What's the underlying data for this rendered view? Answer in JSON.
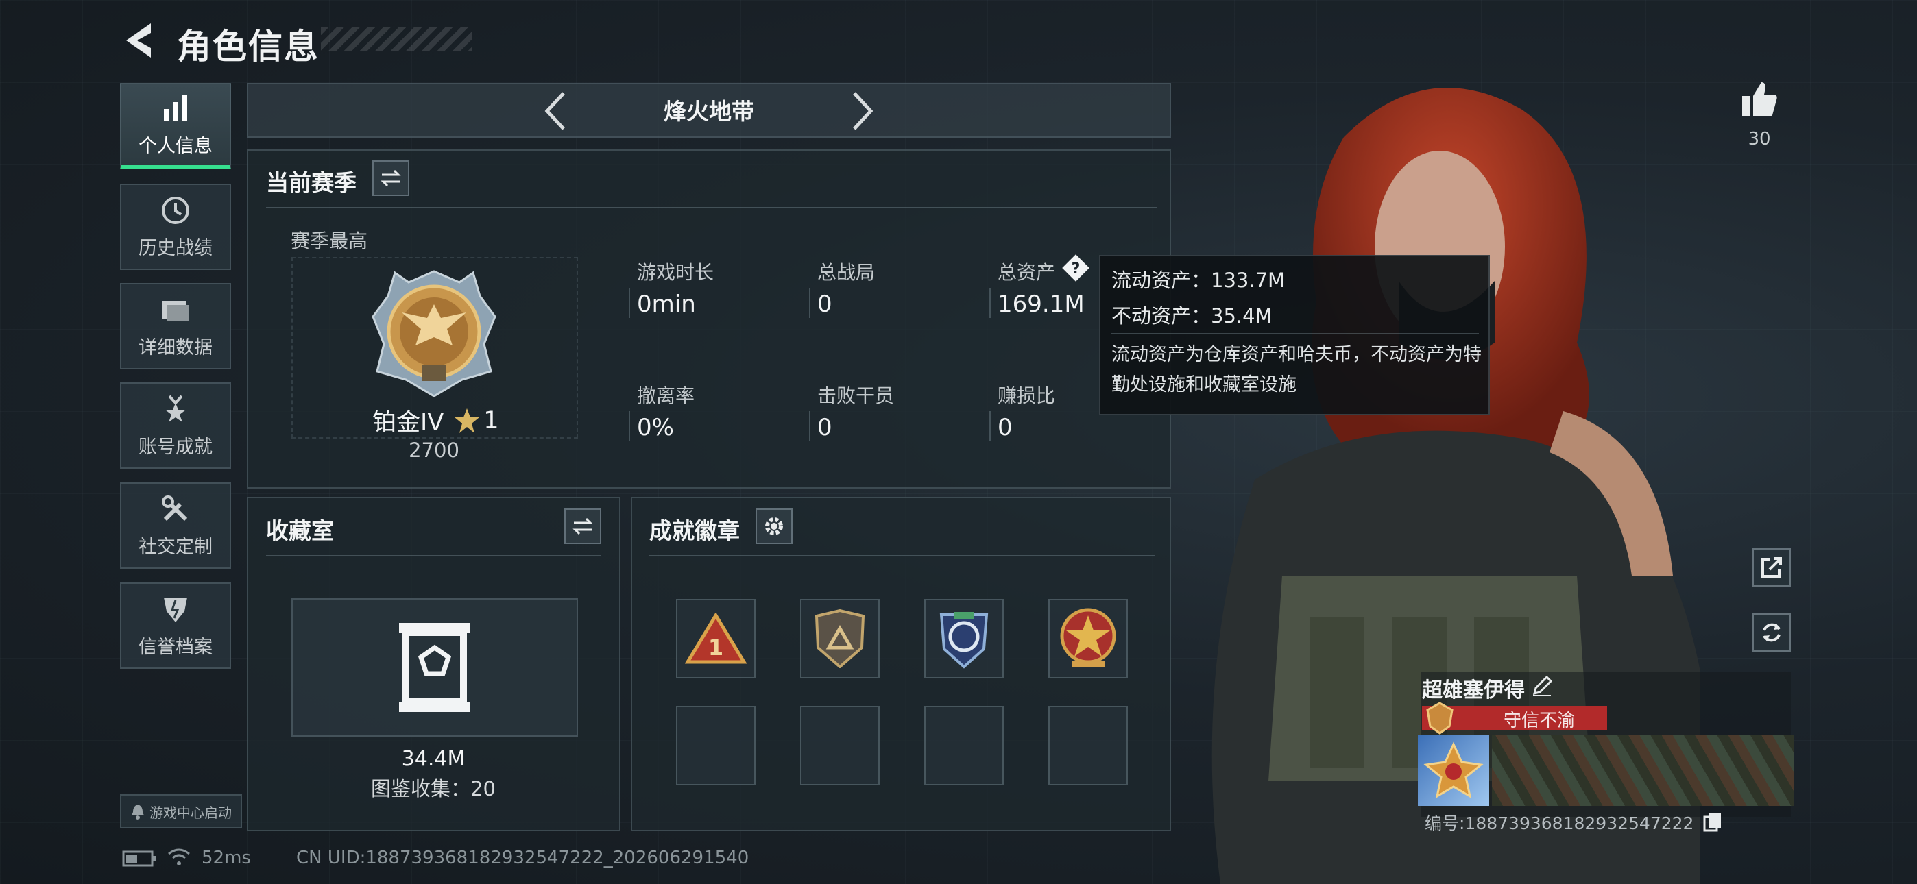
{
  "header": {
    "title": "角色信息"
  },
  "sidebar": {
    "items": [
      {
        "label": "个人信息",
        "icon": "bar-chart-icon"
      },
      {
        "label": "历史战绩",
        "icon": "history-icon"
      },
      {
        "label": "详细数据",
        "icon": "folder-icon"
      },
      {
        "label": "账号成就",
        "icon": "medal-icon"
      },
      {
        "label": "社交定制",
        "icon": "tools-icon"
      },
      {
        "label": "信誉档案",
        "icon": "shield-icon"
      }
    ],
    "launch_label": "游戏中心启动"
  },
  "mode_selector": {
    "current": "烽火地带"
  },
  "season": {
    "title": "当前赛季",
    "best_label": "赛季最高",
    "rank_name": "铂金IV",
    "rank_stars": "1",
    "rank_score": "2700",
    "stats": [
      {
        "label": "游戏时长",
        "value": "0min"
      },
      {
        "label": "总战局",
        "value": "0"
      },
      {
        "label": "总资产",
        "value": "169.1M"
      },
      {
        "label": "撤离率",
        "value": "0%"
      },
      {
        "label": "击败干员",
        "value": "0"
      },
      {
        "label": "赚损比",
        "value": "0"
      }
    ]
  },
  "tooltip": {
    "liquid": "流动资产：133.7M",
    "fixed": "不动资产：35.4M",
    "description": "流动资产为仓库资产和哈夫币，不动资产为特勤处设施和收藏室设施"
  },
  "collection": {
    "title": "收藏室",
    "value": "34.4M",
    "count_label": "图鉴收集：20"
  },
  "achievements": {
    "title": "成就徽章",
    "badges": [
      "triangle-badge-icon",
      "shield-badge-icon",
      "globe-badge-icon",
      "star-badge-icon",
      "",
      "",
      "",
      ""
    ]
  },
  "profile": {
    "likes": "30",
    "name": "超雄塞伊得",
    "title_tag": "守信不渝",
    "id_text": "编号:1887393681829325472​22"
  },
  "status_bar": {
    "ping": "52ms",
    "uid": "CN UID:18873936818293254722​2_202606291540"
  },
  "colors": {
    "accent": "#36e08f",
    "tag_red": "#b22a2a"
  }
}
